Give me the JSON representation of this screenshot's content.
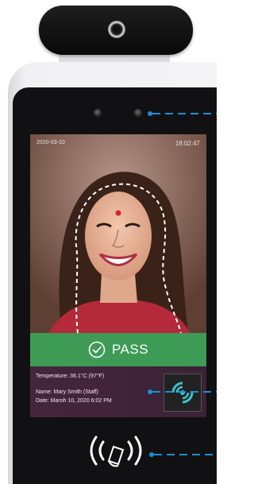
{
  "screen": {
    "status_date": "2020-03-10",
    "status_time": "18:02:47",
    "result_label": "PASS",
    "info": {
      "temperature": "Temperature: 36.1°C (97°F)",
      "name": "Name: Mary Smith (Staff)",
      "date": "Date: Maroh 10, 2020 6:02 PM"
    }
  },
  "colors": {
    "pass_green": "#3d9b56",
    "info_panel": "#45263b",
    "callout_blue": "#1a8fd6",
    "target_dot": "#e0232b"
  },
  "icons": {
    "camera": "camera-lens-icon",
    "check": "check-circle-icon",
    "nfc_card": "nfc-card-icon",
    "nfc_reader": "nfc-hand-wave-icon"
  }
}
